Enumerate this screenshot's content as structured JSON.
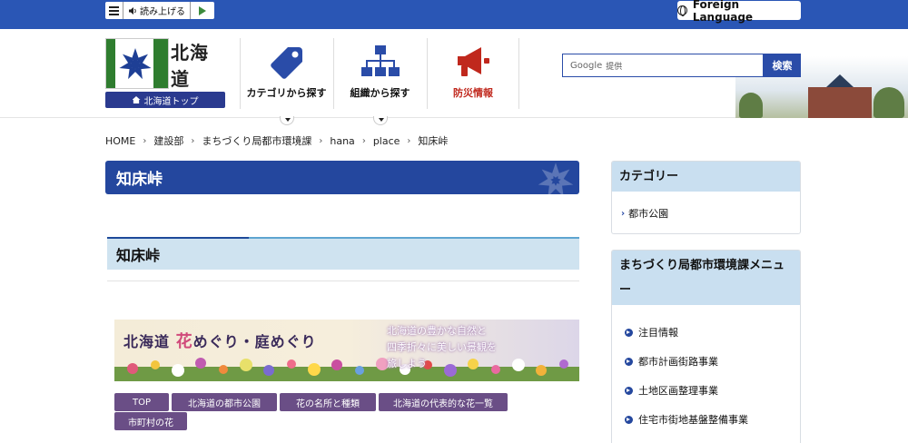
{
  "topbar": {
    "read_aloud_label": "読み上げる",
    "foreign_language_label": "Foreign Language"
  },
  "header": {
    "logo_text": "北海道",
    "home_button": "北海道トップ",
    "nav": [
      {
        "label": "カテゴリから探す",
        "icon": "tag-icon"
      },
      {
        "label": "組織から探す",
        "icon": "org-chart-icon"
      },
      {
        "label": "防災情報",
        "icon": "megaphone-icon"
      }
    ],
    "search": {
      "google_label": "Google",
      "powered_label": "提供",
      "button_label": "検索"
    }
  },
  "breadcrumb": [
    "HOME",
    "建設部",
    "まちづくり局都市環境課",
    "hana",
    "place",
    "知床峠"
  ],
  "main": {
    "page_title": "知床峠",
    "section_title": "知床峠",
    "banner": {
      "title_prefix": "北海道",
      "title_highlight": "花",
      "title_rest": "めぐり・庭めぐり",
      "copy_lines": [
        "北海道の豊かな自然と",
        "四季折々に美しい景観を",
        "旅しよう"
      ]
    },
    "tabs": [
      "TOP",
      "北海道の都市公園",
      "花の名所と種類",
      "北海道の代表的な花一覧",
      "市町村の花"
    ]
  },
  "sidebar": {
    "category": {
      "title": "カテゴリー",
      "links": [
        "都市公園"
      ]
    },
    "menu": {
      "title": "まちづくり局都市環境課メニュー",
      "items": [
        "注目情報",
        "都市計画街路事業",
        "土地区画整理事業",
        "住宅市街地基盤整備事業"
      ]
    }
  },
  "colors": {
    "topbar": "#2a56b5",
    "title_bar": "#24479e",
    "tab": "#6a4e86",
    "sidebar_head": "#c9dff0",
    "disaster": "#c0281d"
  }
}
